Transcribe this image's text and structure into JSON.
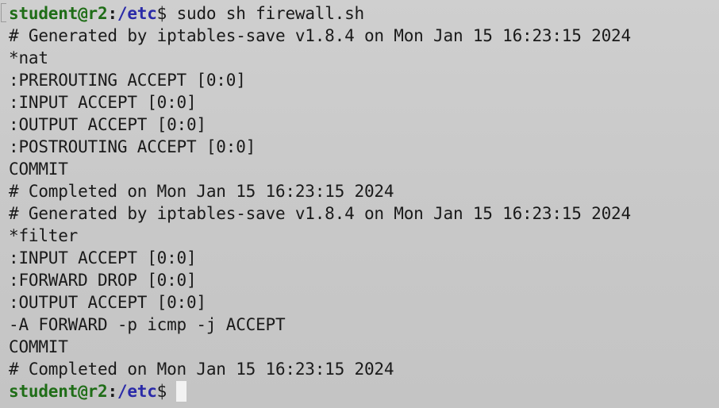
{
  "prompt": {
    "user_host": "student@r2",
    "separator": ":",
    "path": "/etc",
    "dollar": "$"
  },
  "command": " sudo sh firewall.sh",
  "output_lines": [
    "# Generated by iptables-save v1.8.4 on Mon Jan 15 16:23:15 2024",
    "*nat",
    ":PREROUTING ACCEPT [0:0]",
    ":INPUT ACCEPT [0:0]",
    ":OUTPUT ACCEPT [0:0]",
    ":POSTROUTING ACCEPT [0:0]",
    "COMMIT",
    "# Completed on Mon Jan 15 16:23:15 2024",
    "# Generated by iptables-save v1.8.4 on Mon Jan 15 16:23:15 2024",
    "*filter",
    ":INPUT ACCEPT [0:0]",
    ":FORWARD DROP [0:0]",
    ":OUTPUT ACCEPT [0:0]",
    "-A FORWARD -p icmp -j ACCEPT",
    "COMMIT",
    "# Completed on Mon Jan 15 16:23:15 2024"
  ],
  "colors": {
    "background": "#c8c8c8",
    "text": "#1a1a1a",
    "prompt_user": "#1f6d17",
    "prompt_path": "#2a2aa8",
    "cursor": "#f2f2f2"
  }
}
